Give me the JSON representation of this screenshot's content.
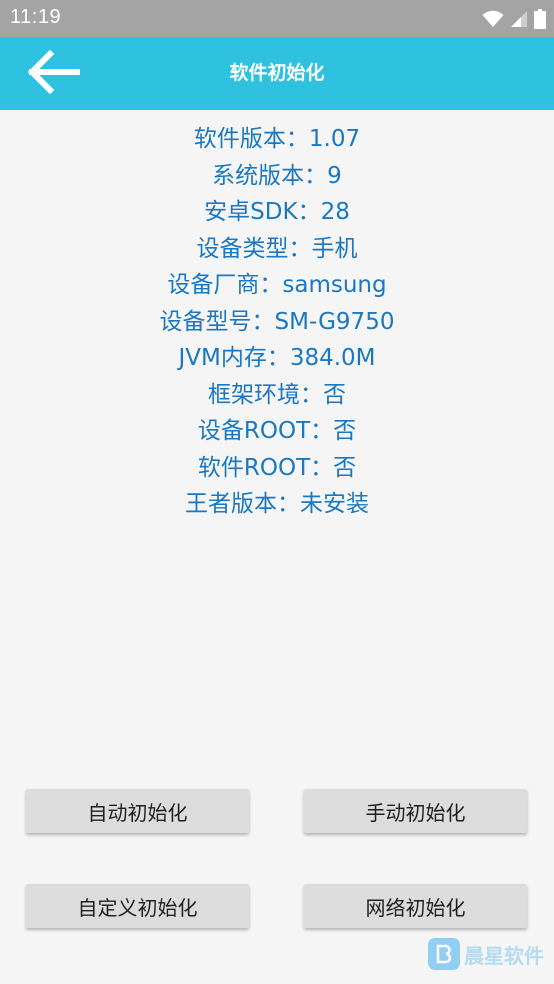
{
  "status_bar": {
    "time": "11:19",
    "icons": [
      "wifi-icon",
      "signal-icon",
      "battery-icon"
    ]
  },
  "app_bar": {
    "title": "软件初始化",
    "back_icon": "arrow-left-icon",
    "background_color": "#2ec2e0"
  },
  "info": [
    {
      "label": "软件版本",
      "value": "1.07"
    },
    {
      "label": "系统版本",
      "value": "9"
    },
    {
      "label": "安卓SDK",
      "value": "28"
    },
    {
      "label": "设备类型",
      "value": "手机"
    },
    {
      "label": "设备厂商",
      "value": "samsung"
    },
    {
      "label": "设备型号",
      "value": "SM-G9750"
    },
    {
      "label": "JVM内存",
      "value": "384.0M"
    },
    {
      "label": "框架环境",
      "value": "否"
    },
    {
      "label": "设备ROOT",
      "value": "否"
    },
    {
      "label": "软件ROOT",
      "value": "否"
    },
    {
      "label": "王者版本",
      "value": "未安装"
    }
  ],
  "info_separator": "：",
  "info_color": "#1a78c2",
  "buttons": {
    "auto_init": "自动初始化",
    "manual_init": "手动初始化",
    "custom_init": "自定义初始化",
    "network_init": "网络初始化"
  },
  "watermark": {
    "icon": "app-logo-icon",
    "text": "晨星软件"
  }
}
